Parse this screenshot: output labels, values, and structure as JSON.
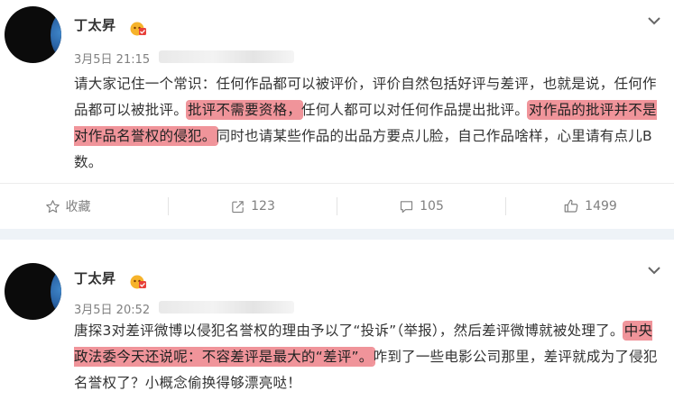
{
  "posts": [
    {
      "author": "丁太昇",
      "date": "3月5日 21:15",
      "text_parts": [
        "请大家记住一个常识：任何作品都可以被评价，评价自然包括好评与差评，也就是说，任何作品都可以被批评。",
        "批评不需要资格，",
        "任何人都可以对任何作品提出批评。",
        "对作品的批评并不是对作品名誉权的侵犯。",
        "同时也请某些作品的出品方要点儿脸，自己作品啥样，心里请有点儿B数。"
      ],
      "actions": {
        "favorite_label": "收藏",
        "repost_count": "123",
        "comment_count": "105",
        "like_count": "1499"
      }
    },
    {
      "author": "丁太昇",
      "date": "3月5日 20:52",
      "text_parts": [
        "唐探3对差评微博以侵犯名誉权的理由予以了“投诉”（举报），然后差评微博就被处理了。",
        "中央政法委今天还说呢：不容差评是最大的“差评”。",
        "咋到了一些电影公司那里，差评就成为了侵犯名誉权了？小概念偷换得够漂亮哒！"
      ]
    }
  ],
  "colors": {
    "highlight": "#f0949a",
    "separator": "#eef3f7",
    "meta_text": "#808080"
  },
  "icons": [
    "chevron-down-icon",
    "vip-badge-icon",
    "star-icon",
    "repost-icon",
    "comment-icon",
    "like-icon"
  ]
}
